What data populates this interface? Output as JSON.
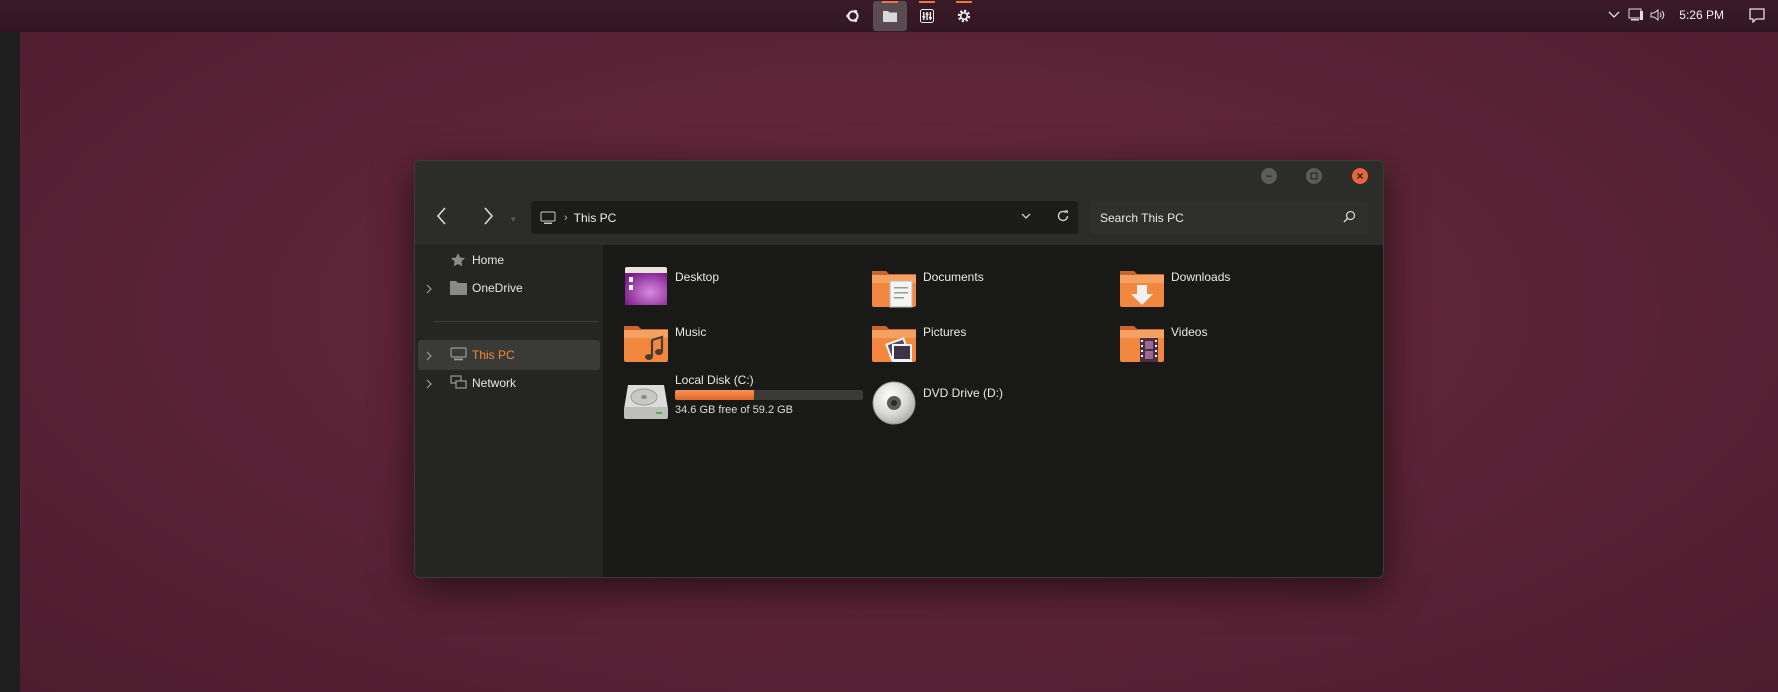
{
  "taskbar": {
    "apps": [
      {
        "name": "ubuntu-icon"
      },
      {
        "name": "files-icon",
        "active": true
      },
      {
        "name": "mixer-icon"
      },
      {
        "name": "settings-icon"
      }
    ],
    "clock": "5:26 PM"
  },
  "window": {
    "nav": {
      "back": "back-icon",
      "forward": "forward-icon"
    },
    "address": {
      "crumb": "This PC"
    },
    "search": {
      "placeholder": "Search This PC"
    },
    "sidebar": {
      "items": [
        {
          "label": "Home"
        },
        {
          "label": "OneDrive"
        },
        {
          "label": "This PC",
          "selected": true
        },
        {
          "label": "Network"
        }
      ]
    },
    "folders": [
      {
        "label": "Desktop"
      },
      {
        "label": "Documents"
      },
      {
        "label": "Downloads"
      },
      {
        "label": "Music"
      },
      {
        "label": "Pictures"
      },
      {
        "label": "Videos"
      }
    ],
    "drives": [
      {
        "label": "Local Disk (C:)",
        "free_text": "34.6 GB free of 59.2 GB",
        "used_fraction": 0.42
      },
      {
        "label": "DVD Drive (D:)"
      }
    ]
  },
  "colors": {
    "accent": "#f08a3a",
    "close": "#e6643a"
  }
}
